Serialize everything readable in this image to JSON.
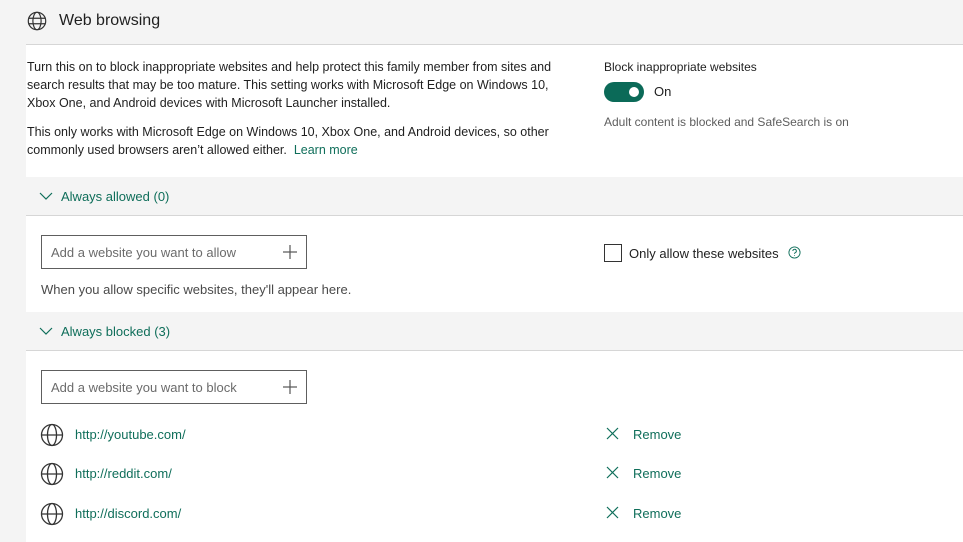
{
  "section": {
    "title": "Web browsing",
    "icon": "globe-icon"
  },
  "description": {
    "paragraph1": "Turn this on to block inappropriate websites and help protect this family member from sites and search results that may be too mature. This setting works with Microsoft Edge on Windows 10, Xbox One, and Android devices with Microsoft Launcher installed.",
    "paragraph2": "This only works with Microsoft Edge on Windows 10, Xbox One, and Android devices, so other commonly used browsers aren’t allowed either.",
    "learn_more": "Learn more"
  },
  "block_setting": {
    "label": "Block inappropriate websites",
    "state": "On",
    "enabled": true,
    "status": "Adult content is blocked and SafeSearch is on"
  },
  "always_allowed": {
    "title": "Always allowed (0)",
    "input_placeholder": "Add a website you want to allow",
    "input_value": "",
    "empty_hint": "When you allow specific websites, they'll appear here.",
    "only_allow_label": "Only allow these websites",
    "only_allow_checked": false
  },
  "always_blocked": {
    "title": "Always blocked (3)",
    "input_placeholder": "Add a website you want to block",
    "input_value": "",
    "sites": [
      {
        "url": "http://youtube.com/",
        "remove_label": "Remove"
      },
      {
        "url": "http://reddit.com/",
        "remove_label": "Remove"
      },
      {
        "url": "http://discord.com/",
        "remove_label": "Remove"
      }
    ]
  },
  "colors": {
    "accent": "#0f6e5a",
    "toggle_on": "#0b6a58",
    "section_bg": "#f4f4f4",
    "card_bg": "#ffffff"
  }
}
